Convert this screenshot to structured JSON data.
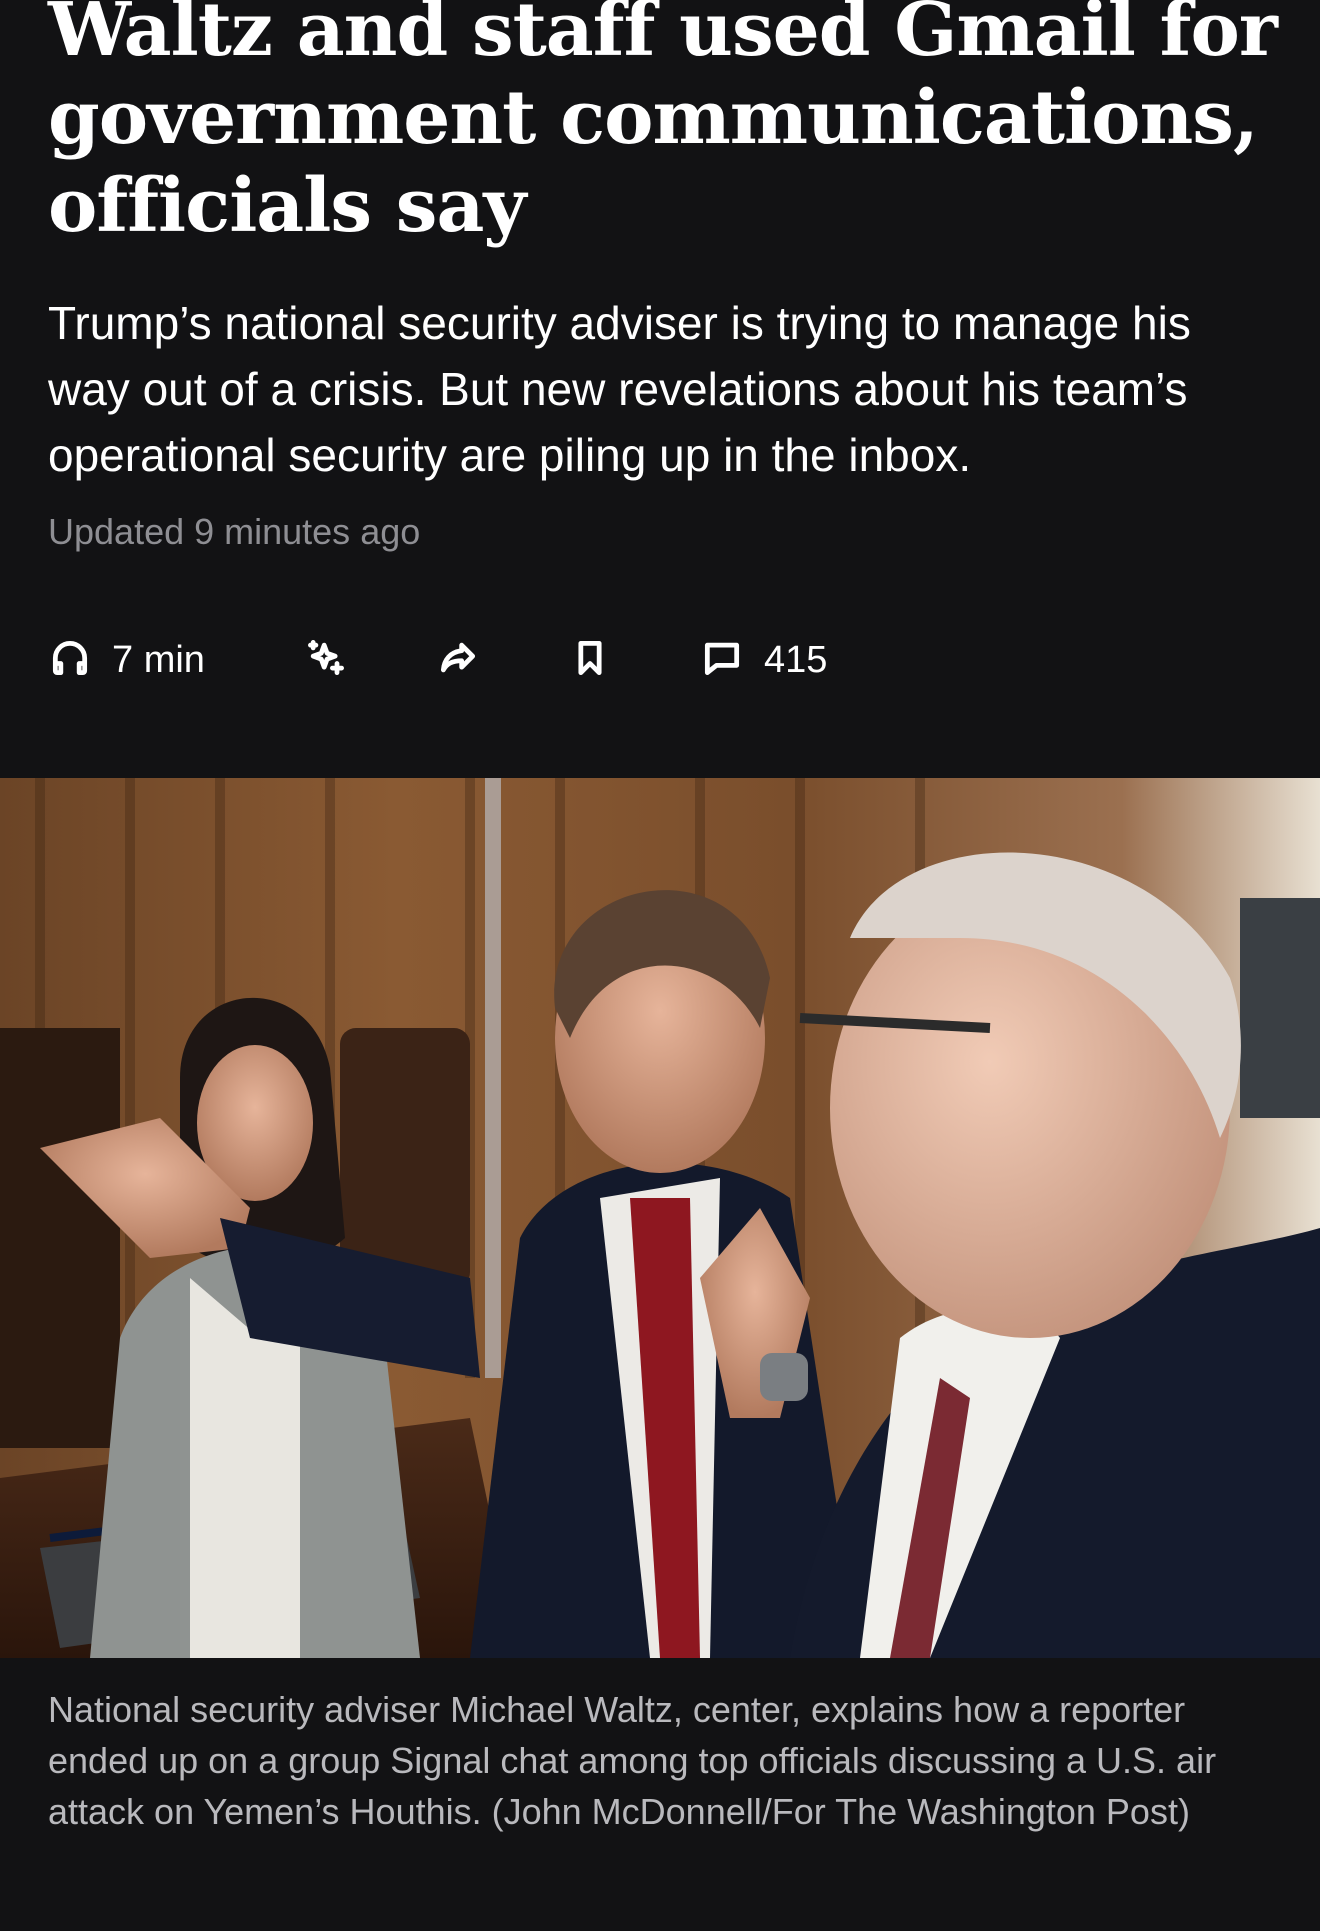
{
  "article": {
    "headline": "Waltz and staff used Gmail for government communications, officials say",
    "dek": "Trump’s national security adviser is trying to manage his way out of a crisis. But new revelations about his team’s operational security are piling up in the inbox.",
    "updated": "Updated 9 minutes ago"
  },
  "toolbar": {
    "listen_label": "7 min",
    "comments_count": "415",
    "icons": [
      "headphones-icon",
      "sparkle-icon",
      "share-icon",
      "bookmark-icon",
      "comment-icon"
    ]
  },
  "photo": {
    "caption": "National security adviser Michael Waltz, center, explains how a reporter ended up on a group Signal chat among top officials discussing a U.S. air attack on Yemen’s Houthis. (John McDonnell/For The Washington Post)"
  },
  "colors": {
    "background": "#121214",
    "text": "#ffffff",
    "muted_text": "#8e8e93",
    "caption_text": "#b9b9bd"
  }
}
